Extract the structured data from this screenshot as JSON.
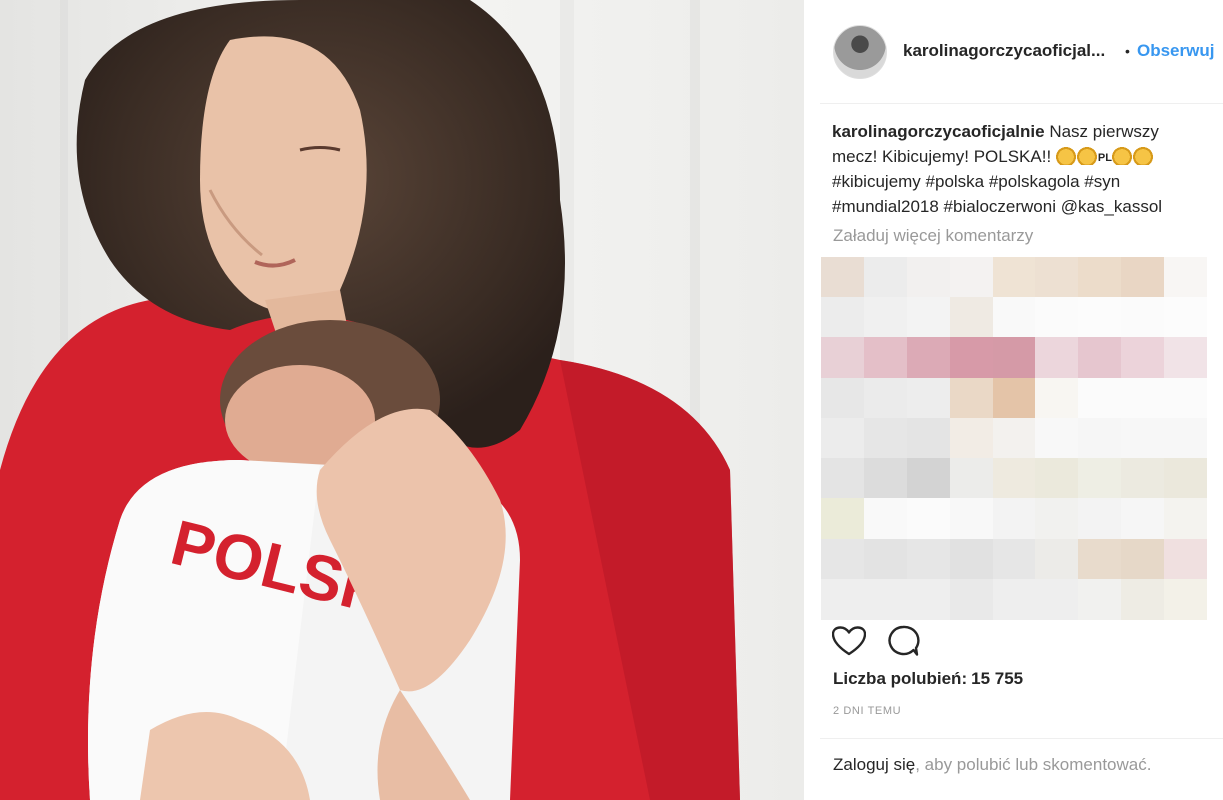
{
  "post": {
    "username": "karolinagorczycaoficjal...",
    "follow_dot": "•",
    "follow_label": "Obserwuj"
  },
  "photo": {
    "shirt_text": "POLSKA",
    "description": "photo"
  },
  "caption": {
    "username": "karolinagorczycaoficjalnie",
    "text_1": "Nasz pierwszy mecz! Kibicujemy! POLSKA!!",
    "flag_text": "PL",
    "text_2": "#kibicujemy #polska #polskagola #syn #mundial2018 #bialoczerwoni @kas_kassol"
  },
  "comments": {
    "load_more": "Załaduj więcej komentarzy"
  },
  "actions": {
    "like_icon": "heart-icon",
    "comment_icon": "comment-icon"
  },
  "likes": {
    "label": "Liczba polubień:",
    "count": "15 755"
  },
  "timestamp": "2 DNI TEMU",
  "login": {
    "link": "Zaloguj się",
    "text": ", aby polubić lub skomentować."
  },
  "colors": {
    "accent": "#3897f0",
    "muted": "#999999",
    "text": "#262626"
  }
}
